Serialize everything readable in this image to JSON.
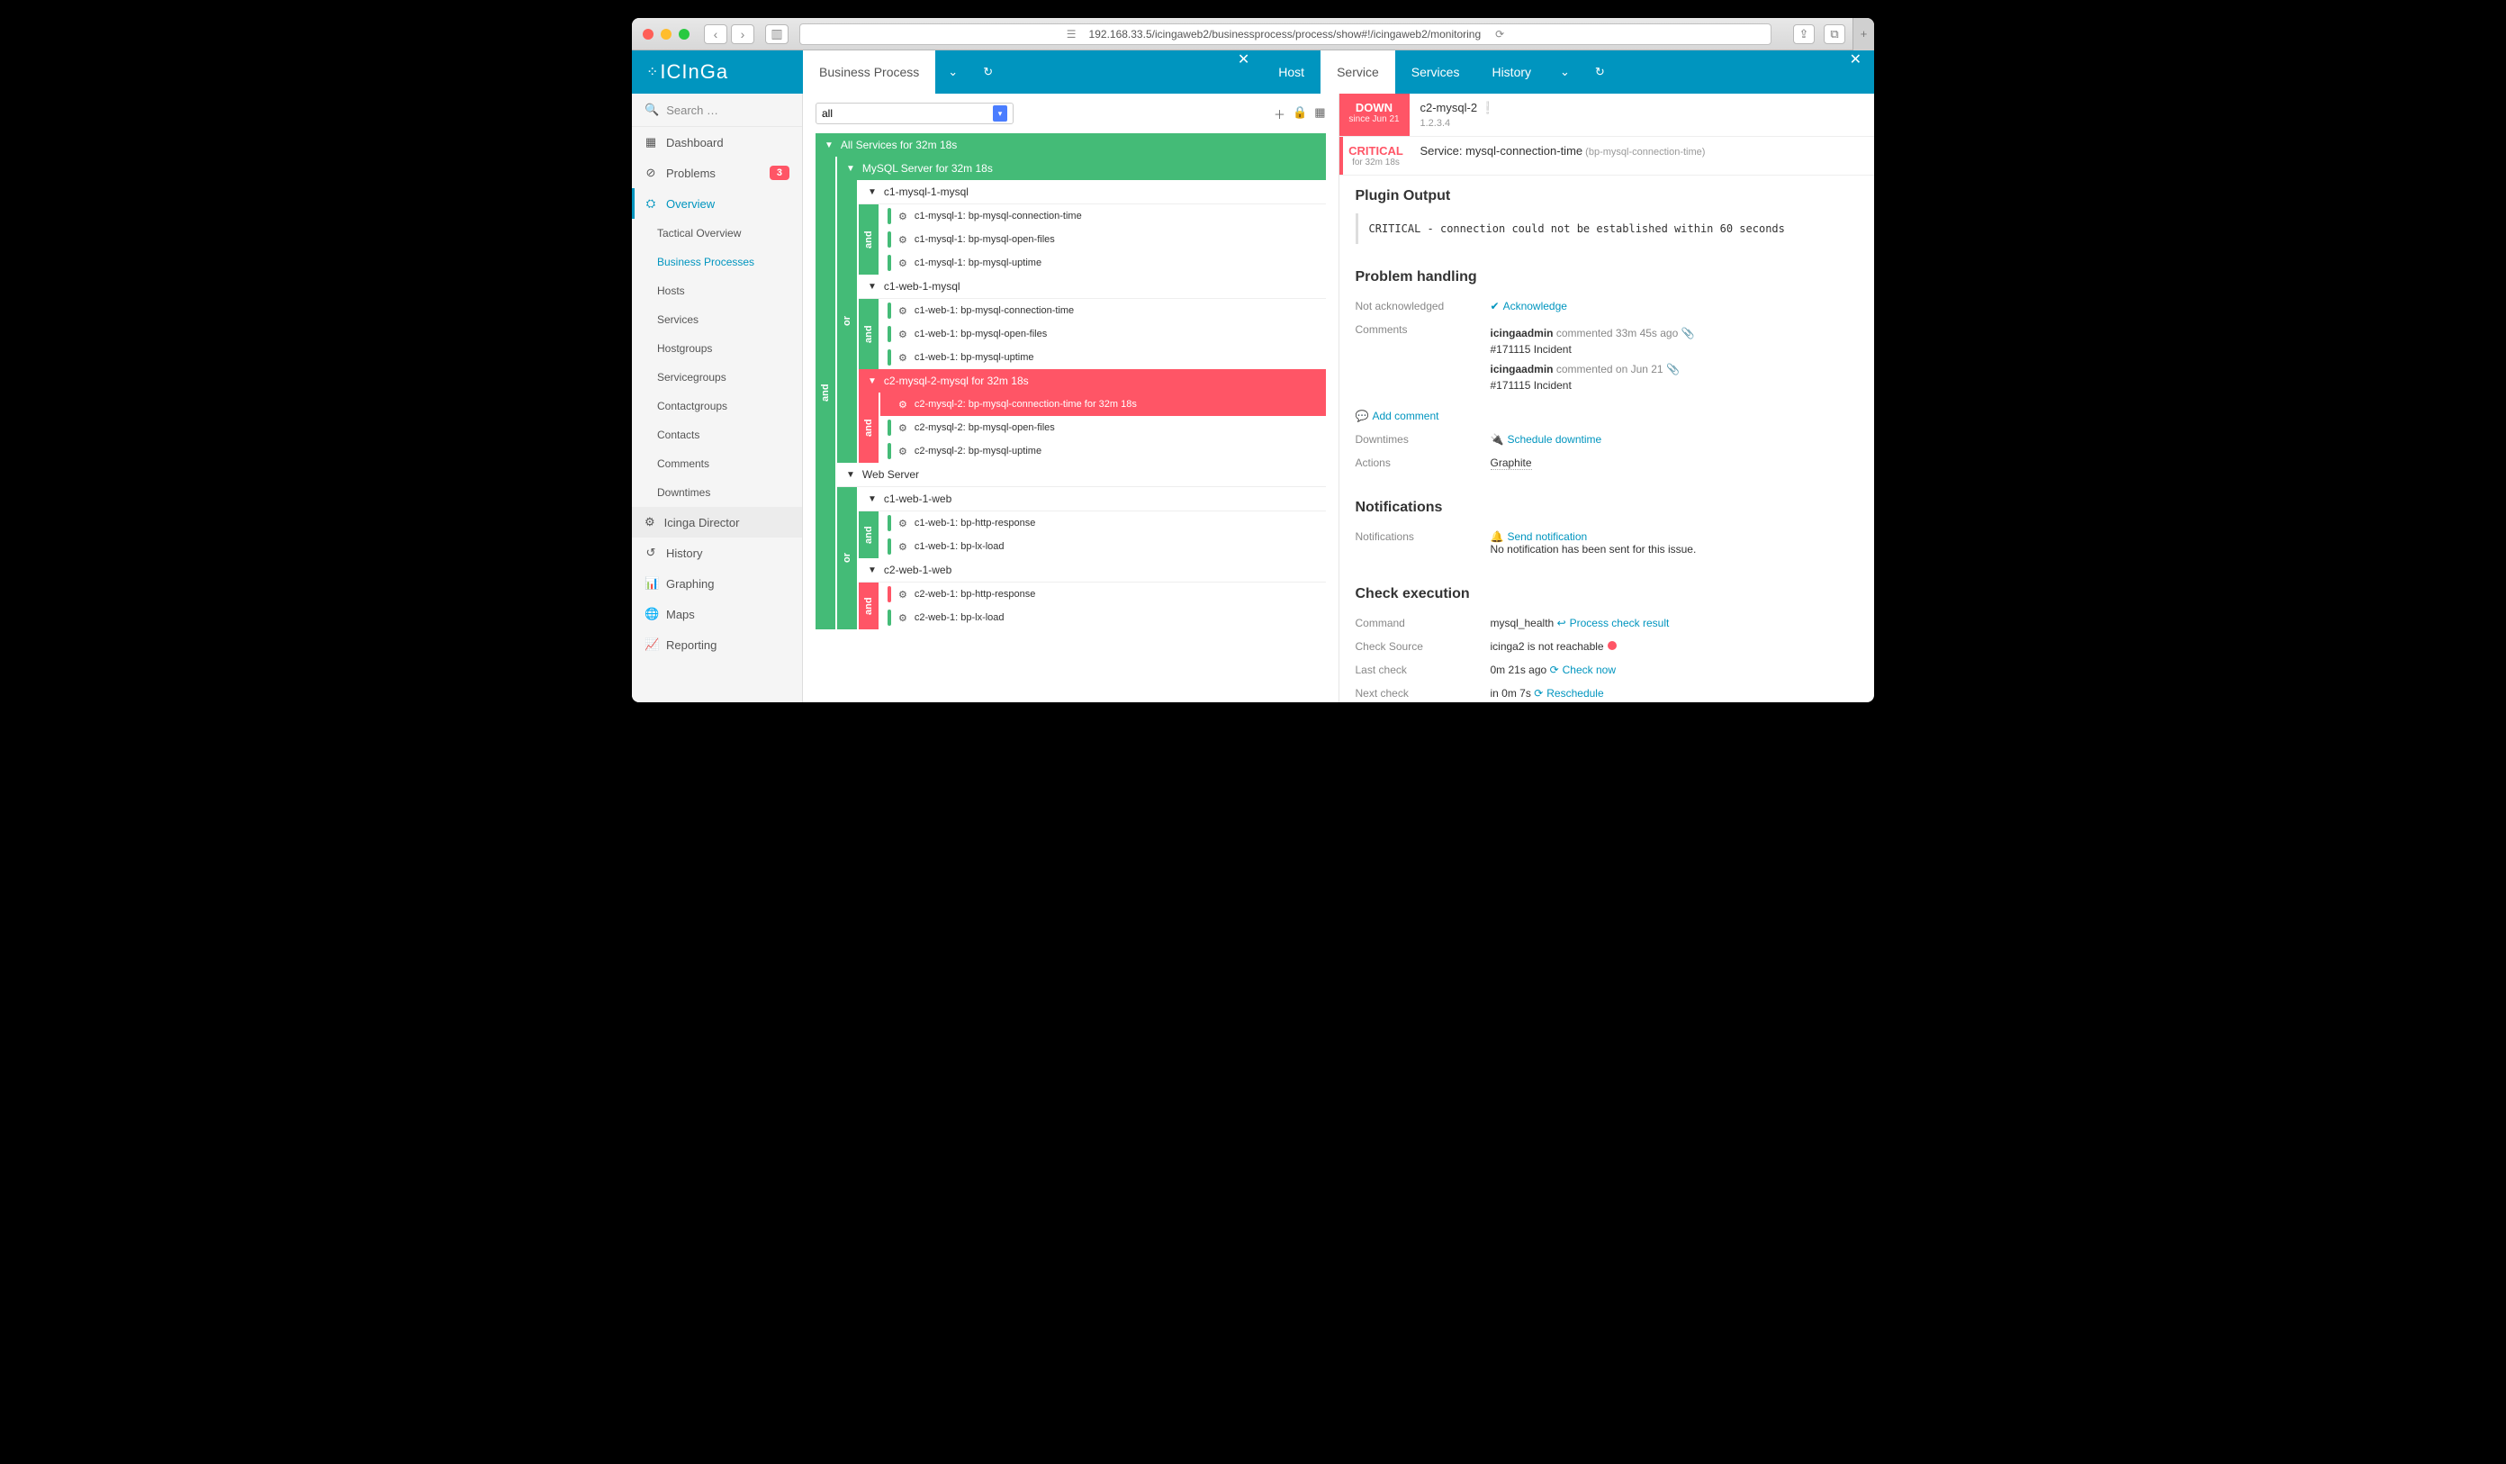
{
  "browser": {
    "url": "192.168.33.5/icingaweb2/businessprocess/process/show#!/icingaweb2/monitoring"
  },
  "logo": "ICInGa",
  "top_tabs_left": {
    "main": "Business Process"
  },
  "top_tabs_right": {
    "host": "Host",
    "service": "Service",
    "services": "Services",
    "history": "History"
  },
  "sidebar": {
    "search": "Search …",
    "dashboard": "Dashboard",
    "problems": "Problems",
    "problems_badge": "3",
    "overview": "Overview",
    "overview_items": [
      "Tactical Overview",
      "Business Processes",
      "Hosts",
      "Services",
      "Hostgroups",
      "Servicegroups",
      "Contactgroups",
      "Contacts",
      "Comments",
      "Downtimes"
    ],
    "director": "Icinga Director",
    "history": "History",
    "graphing": "Graphing",
    "maps": "Maps",
    "reporting": "Reporting"
  },
  "bp": {
    "filter": "all",
    "root": "All Services for 32m 18s",
    "mysql_server": "MySQL Server for 32m 18s",
    "c1_mysql_1": "c1-mysql-1-mysql",
    "c1_mysql_1_items": [
      "c1-mysql-1: bp-mysql-connection-time",
      "c1-mysql-1: bp-mysql-open-files",
      "c1-mysql-1: bp-mysql-uptime"
    ],
    "c1_web_1_mysql": "c1-web-1-mysql",
    "c1_web_1_mysql_items": [
      "c1-web-1: bp-mysql-connection-time",
      "c1-web-1: bp-mysql-open-files",
      "c1-web-1: bp-mysql-uptime"
    ],
    "c2_mysql_2": "c2-mysql-2-mysql for 32m 18s",
    "c2_mysql_2_crit": "c2-mysql-2: bp-mysql-connection-time for 32m 18s",
    "c2_mysql_2_items": [
      "c2-mysql-2: bp-mysql-open-files",
      "c2-mysql-2: bp-mysql-uptime"
    ],
    "web_server": "Web Server",
    "c1_web_1_web": "c1-web-1-web",
    "c1_web_1_web_items": [
      "c1-web-1: bp-http-response",
      "c1-web-1: bp-lx-load"
    ],
    "c2_web_1_web": "c2-web-1-web",
    "c2_web_1_web_items": [
      "c2-web-1: bp-http-response",
      "c2-web-1: bp-lx-load"
    ],
    "op_and": "and",
    "op_or": "or"
  },
  "detail": {
    "down": "DOWN",
    "down_since": "since Jun 21",
    "host": "c2-mysql-2",
    "ip": "1.2.3.4",
    "critical": "CRITICAL",
    "crit_for": "for 32m 18s",
    "service_prefix": "Service: ",
    "service_name": "mysql-connection-time",
    "service_suffix": " (bp-mysql-connection-time)",
    "plugin_output_h": "Plugin Output",
    "plugin_output": "CRITICAL - connection could not be established within 60 seconds",
    "problem_handling_h": "Problem handling",
    "not_ack": "Not acknowledged",
    "acknowledge": "Acknowledge",
    "comments_label": "Comments",
    "add_comment": "Add comment",
    "comment1_meta": "icingaadmin commented 33m 45s ago",
    "comment1_text": "#171115 Incident",
    "comment2_meta": "icingaadmin commented on Jun 21",
    "comment2_text": "#171115 Incident",
    "downtimes_label": "Downtimes",
    "schedule_downtime": "Schedule downtime",
    "actions_label": "Actions",
    "graphite": "Graphite",
    "notifications_h": "Notifications",
    "notifications_label": "Notifications",
    "send_notification": "Send notification",
    "no_notification": "No notification has been sent for this issue.",
    "check_exec_h": "Check execution",
    "command_label": "Command",
    "command_val": "mysql_health",
    "process_check": "Process check result",
    "check_source_label": "Check Source",
    "check_source_val": "icinga2 is not reachable",
    "last_check_label": "Last check",
    "last_check_val": "0m 21s ago",
    "check_now": "Check now",
    "next_check_label": "Next check",
    "next_check_val": "in 0m 7s",
    "reschedule": "Reschedule"
  }
}
